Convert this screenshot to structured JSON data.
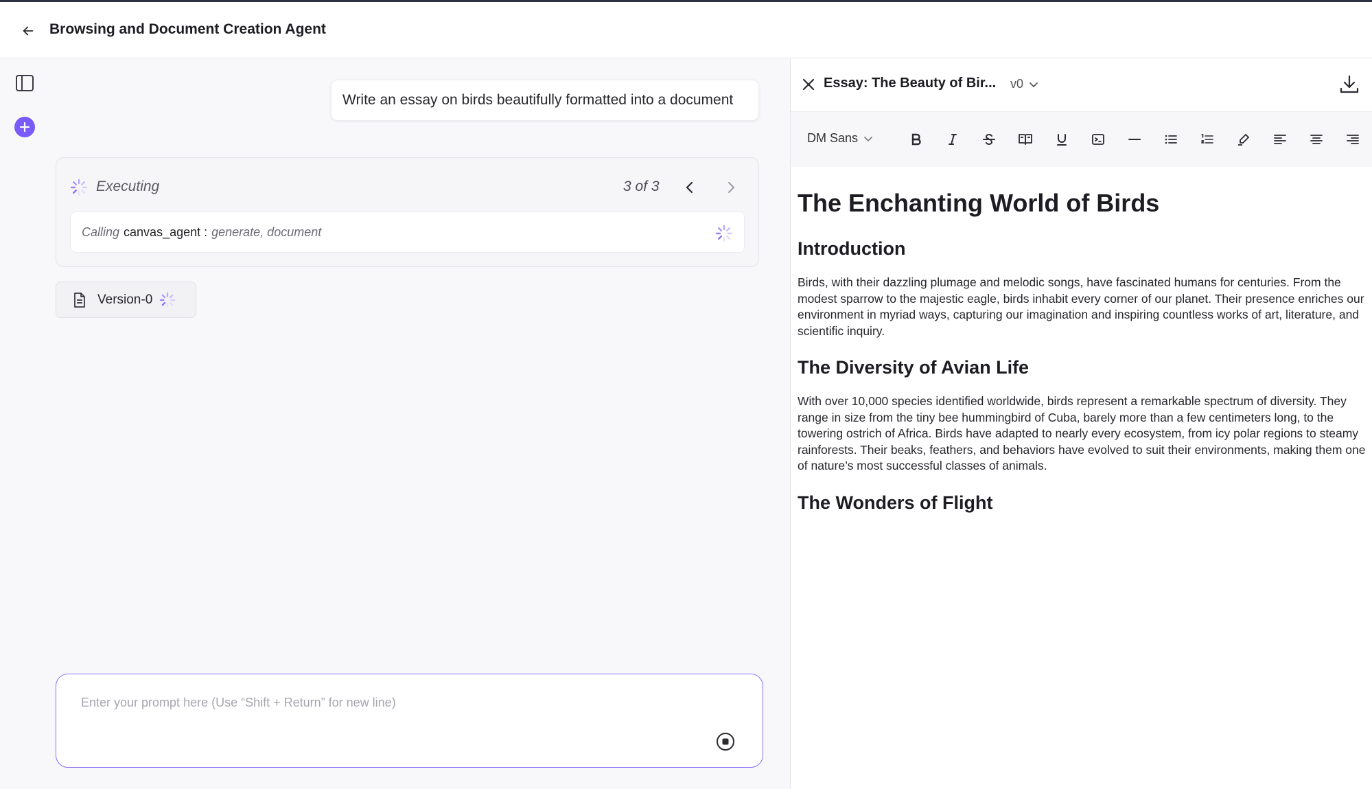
{
  "header": {
    "title": "Browsing and Document Creation Agent"
  },
  "chat": {
    "user_message": "Write an essay on birds beautifully formatted into a document",
    "execution": {
      "status": "Executing",
      "step_count": "3 of 3",
      "call_prefix": "Calling",
      "call_tool": "canvas_agent :",
      "call_args": "generate, document"
    },
    "version_chip": "Version-0"
  },
  "prompt": {
    "placeholder": "Enter your prompt here (Use “Shift + Return” for new line)"
  },
  "document": {
    "title": "Essay: The Beauty of Bir...",
    "version": "v0",
    "font": "DM Sans",
    "h1": "The Enchanting World of Birds",
    "sections": [
      {
        "heading": "Introduction",
        "body": "Birds, with their dazzling plumage and melodic songs, have fascinated humans for centuries. From the modest sparrow to the majestic eagle, birds inhabit every corner of our planet. Their presence enriches our environment in myriad ways, capturing our imagination and inspiring countless works of art, literature, and scientific inquiry."
      },
      {
        "heading": "The Diversity of Avian Life",
        "body": "With over 10,000 species identified worldwide, birds represent a remarkable spectrum of diversity. They range in size from the tiny bee hummingbird of Cuba, barely more than a few centimeters long, to the towering ostrich of Africa. Birds have adapted to nearly every ecosystem, from icy polar regions to steamy rainforests. Their beaks, feathers, and behaviors have evolved to suit their environments, making them one of nature’s most successful classes of animals."
      },
      {
        "heading": "The Wonders of Flight",
        "body": ""
      }
    ]
  },
  "colors": {
    "accent": "#7a5af8",
    "border": "#8b6cf6"
  }
}
